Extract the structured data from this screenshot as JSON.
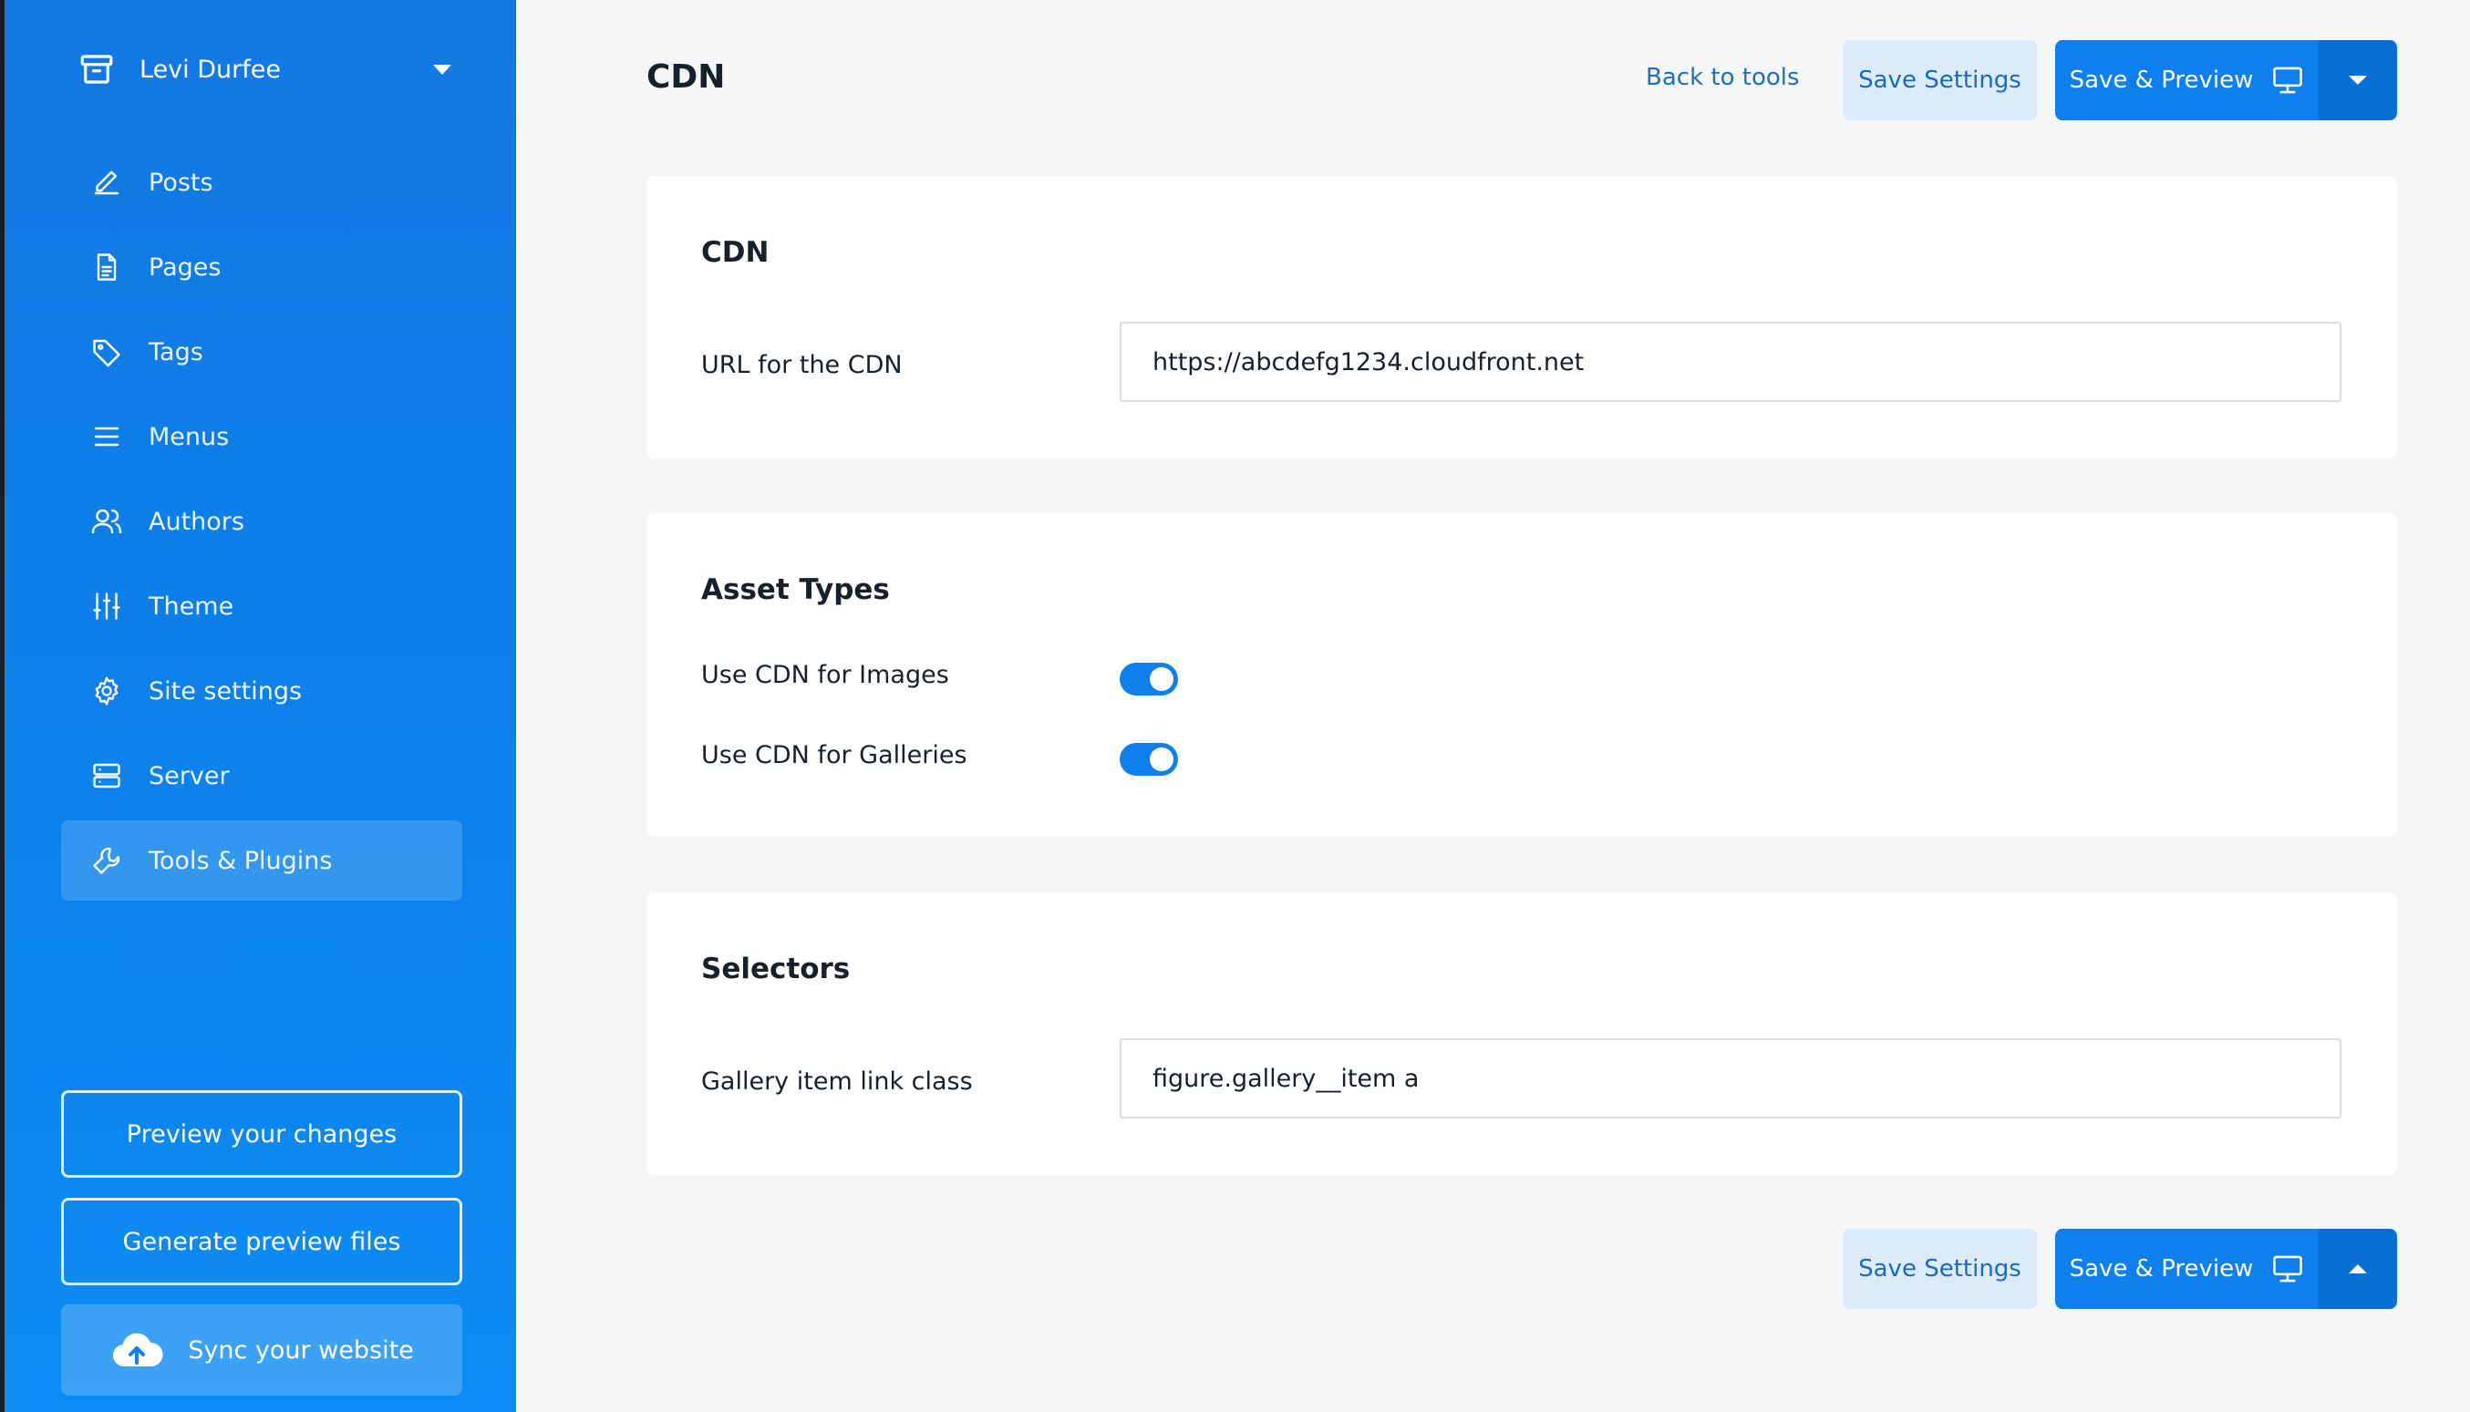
{
  "sidebar": {
    "site_name": "Levi Durfee",
    "items": [
      {
        "label": "Posts",
        "icon": "pencil-icon"
      },
      {
        "label": "Pages",
        "icon": "page-icon"
      },
      {
        "label": "Tags",
        "icon": "tag-icon"
      },
      {
        "label": "Menus",
        "icon": "menu-icon"
      },
      {
        "label": "Authors",
        "icon": "users-icon"
      },
      {
        "label": "Theme",
        "icon": "sliders-icon"
      },
      {
        "label": "Site settings",
        "icon": "gear-icon"
      },
      {
        "label": "Server",
        "icon": "server-icon"
      },
      {
        "label": "Tools & Plugins",
        "icon": "wrench-icon",
        "active": true
      }
    ],
    "preview_label": "Preview your changes",
    "generate_label": "Generate preview files",
    "sync_label": "Sync your website"
  },
  "header": {
    "title": "CDN",
    "back_label": "Back to tools",
    "save_label": "Save Settings",
    "save_preview_label": "Save & Preview"
  },
  "cards": {
    "cdn": {
      "title": "CDN",
      "url_label": "URL for the CDN",
      "url_value": "https://abcdefg1234.cloudfront.net"
    },
    "assets": {
      "title": "Asset Types",
      "images_label": "Use CDN for Images",
      "images_enabled": true,
      "galleries_label": "Use CDN for Galleries",
      "galleries_enabled": true
    },
    "selectors": {
      "title": "Selectors",
      "gallery_label": "Gallery item link class",
      "gallery_value": "figure.gallery__item a"
    }
  },
  "footer": {
    "save_label": "Save Settings",
    "save_preview_label": "Save & Preview"
  },
  "colors": {
    "sidebar": "#0d80ee",
    "primary_button": "#0d80ee",
    "light_button": "#dcebfa",
    "link": "#1f6fbf",
    "background": "#f5f6f8"
  }
}
